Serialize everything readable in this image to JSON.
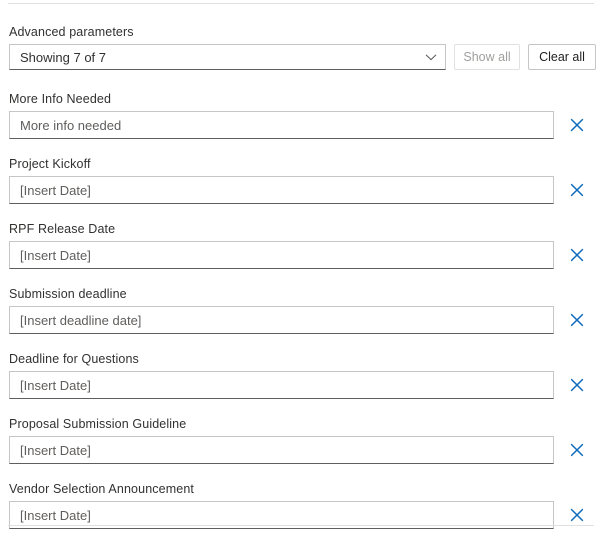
{
  "panel": {
    "accent_color": "#0f6cbd",
    "border_color": "#c8c6c4",
    "divider_color": "#e1dfdd",
    "label_color": "#323130",
    "placeholder_color": "#605e5c"
  },
  "advanced": {
    "label": "Advanced parameters",
    "combobox_value": "Showing 7 of 7",
    "chevron_icon": "chevron-down-icon",
    "show_all_label": "Show all",
    "show_all_disabled": true,
    "clear_all_label": "Clear all",
    "clear_all_disabled": false
  },
  "parameters": [
    {
      "label": "More Info Needed",
      "value": "More info needed",
      "remove_icon": "close-icon"
    },
    {
      "label": "Project Kickoff",
      "value": "[Insert Date]",
      "remove_icon": "close-icon"
    },
    {
      "label": "RPF Release Date",
      "value": "[Insert Date]",
      "remove_icon": "close-icon"
    },
    {
      "label": "Submission deadline",
      "value": "[Insert deadline date]",
      "remove_icon": "close-icon"
    },
    {
      "label": "Deadline for Questions",
      "value": "[Insert Date]",
      "remove_icon": "close-icon"
    },
    {
      "label": "Proposal Submission Guideline",
      "value": "[Insert Date]",
      "remove_icon": "close-icon"
    },
    {
      "label": "Vendor Selection Announcement",
      "value": "[Insert Date]",
      "remove_icon": "close-icon"
    }
  ]
}
